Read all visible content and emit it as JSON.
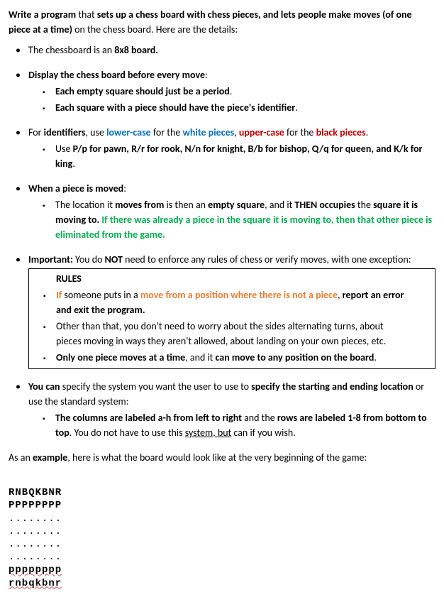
{
  "intro": {
    "p1_a": "Write a program",
    "p1_b": " that ",
    "p1_c": "sets up a chess board with chess pieces, and lets people make moves (of one piece at a time)",
    "p1_d": " on the chess board.  Here are the details:"
  },
  "items": {
    "i1_a": "The chessboard is an ",
    "i1_b": "8x8 board.",
    "i2": "Display the chess board before every move",
    "i2_s1": "Each empty square should just be a period",
    "i2_s2": "Each square with a piece should have the piece's identifier",
    "i3_a": "For ",
    "i3_b": "identifiers",
    "i3_c": ", use ",
    "i3_d": "lower-case",
    "i3_e": " for the ",
    "i3_f": "white pieces",
    "i3_g": ", ",
    "i3_h": "upper-case",
    "i3_i": " for the ",
    "i3_j": "black pieces",
    "i3_k": ".",
    "i3_s1_a": "Use ",
    "i3_s1_b": "P/p for pawn, R/r for rook, N/n for knight, B/b for bishop, Q/q for queen, and K/k for king",
    "i3_s1_c": ".",
    "i4": "When a piece is moved",
    "i4_s1_a": "The location it ",
    "i4_s1_b": "moves from",
    "i4_s1_c": " is then an ",
    "i4_s1_d": "empty square",
    "i4_s1_e": ", and it ",
    "i4_s1_f": "THEN occupies",
    "i4_s1_g": " the ",
    "i4_s1_h": "square it is moving to.",
    "i4_s1_i": "  If there was already a piece in the square it is moving to, then that other piece is eliminated from the game.",
    "i5_a": "Important:",
    "i5_b": " You do ",
    "i5_c": "NOT",
    "i5_d": " need to enforce any rules of chess or verify moves, with one exception:",
    "i5_rules": "RULES",
    "i5_s1_a": "If",
    "i5_s1_b": " someone puts in a ",
    "i5_s1_c": "move from a position where there is not a piece",
    "i5_s1_d": ", ",
    "i5_s1_e": "report an error and exit the program.",
    "i5_s2": "Other than that, you don't need to worry about the sides alternating turns, about pieces moving in ways they aren't allowed, about landing on your own pieces, etc.",
    "i5_s3_a": "Only one piece moves at a time",
    "i5_s3_b": ", and it ",
    "i5_s3_c": "can move to any position on the board",
    "i5_s3_d": ".",
    "i6_a": "You can",
    "i6_b": " specify the system you want the user to use to ",
    "i6_c": "specify the starting and ending location",
    "i6_d": " or use the standard system:",
    "i6_s1_a": "The columns are labeled a-h from left to right",
    "i6_s1_b": " and the ",
    "i6_s1_c": "rows are labeled 1-8 from bottom to top",
    "i6_s1_d": ".  You do not have to use this ",
    "i6_s1_e": "system, but",
    "i6_s1_f": " can if you wish."
  },
  "example": {
    "text_a": "As an ",
    "text_b": "example",
    "text_c": ", here is what the board would look like at the very beginning of the game:"
  },
  "board": {
    "r1": "RNBQKBNR",
    "r2": "PPPPPPPP",
    "r3": "........",
    "r4": "........",
    "r5": "........",
    "r6": "........",
    "r7": "pppppppp",
    "r8": "rnbqkbnr"
  }
}
